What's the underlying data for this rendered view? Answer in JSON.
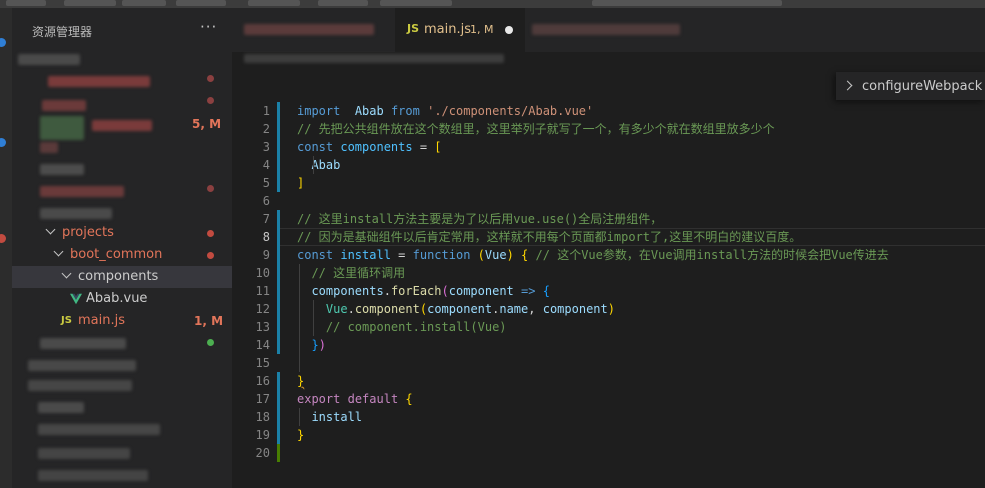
{
  "explorer": {
    "title": "资源管理器",
    "more": "···",
    "tree": [
      {
        "label": "projects",
        "indent": 1,
        "color": "#e2755a",
        "indicator": "#c24b40"
      },
      {
        "label": "boot_common",
        "indent": 2,
        "color": "#e2755a",
        "indicator": "#c24b40"
      },
      {
        "label": "components",
        "indent": 3,
        "color": "#cccccc",
        "selected": true
      },
      {
        "label": "Abab.vue",
        "indent": 4,
        "color": "#cccccc",
        "icon": "vue-icon"
      },
      {
        "label": "main.js",
        "indent": 3,
        "color": "#e2755a",
        "icon": "js-icon",
        "badge": "1, M"
      }
    ],
    "badges": {
      "top": "5, M"
    }
  },
  "tab": {
    "icon": "JS",
    "name": "main.js",
    "badge": "1, M",
    "dirty": true
  },
  "sticky_scroll": {
    "label": "configureWebpack"
  },
  "editor": {
    "active_line": 8,
    "lines": [
      [
        [
          "kw",
          "import"
        ],
        [
          "",
          "  "
        ],
        [
          "var",
          "Abab"
        ],
        [
          "",
          " "
        ],
        [
          "kw",
          "from"
        ],
        [
          "",
          " "
        ],
        [
          "str",
          "'./components/Abab.vue'"
        ]
      ],
      [
        [
          "cm",
          "// 先把公共组件放在这个数组里，这里举列子就写了一个，有多少个就在数组里放多少个"
        ]
      ],
      [
        [
          "kw",
          "const"
        ],
        [
          "",
          " "
        ],
        [
          "cst",
          "components"
        ],
        [
          "",
          " = "
        ],
        [
          "br1",
          "["
        ]
      ],
      [
        [
          "",
          "  "
        ],
        [
          "var",
          "Abab"
        ]
      ],
      [
        [
          "br1",
          "]"
        ]
      ],
      [],
      [
        [
          "cm",
          "// 这里install方法主要是为了以后用vue.use()全局注册组件，"
        ]
      ],
      [
        [
          "cm",
          "// 因为是基础组件以后肯定常用，这样就不用每个页面都import了,这里不明白的建议百度。"
        ]
      ],
      [
        [
          "kw",
          "const"
        ],
        [
          "",
          " "
        ],
        [
          "cst",
          "install"
        ],
        [
          "",
          " = "
        ],
        [
          "kw",
          "function"
        ],
        [
          "",
          " "
        ],
        [
          "br1",
          "("
        ],
        [
          "var",
          "Vue"
        ],
        [
          "br1",
          ")"
        ],
        [
          "",
          " "
        ],
        [
          "br1",
          "{"
        ],
        [
          "",
          " "
        ],
        [
          "cm",
          "// 这个Vue参数，在Vue调用install方法的时候会把Vue传进去"
        ]
      ],
      [
        [
          "",
          "  "
        ],
        [
          "cm",
          "// 这里循环调用"
        ]
      ],
      [
        [
          "",
          "  "
        ],
        [
          "var",
          "components"
        ],
        [
          "",
          "."
        ],
        [
          "fn",
          "forEach"
        ],
        [
          "br2",
          "("
        ],
        [
          "var",
          "component"
        ],
        [
          "",
          " "
        ],
        [
          "kw",
          "=>"
        ],
        [
          "",
          " "
        ],
        [
          "br3",
          "{"
        ]
      ],
      [
        [
          "",
          "    "
        ],
        [
          "cls",
          "Vue"
        ],
        [
          "",
          "."
        ],
        [
          "fn",
          "component"
        ],
        [
          "br1",
          "("
        ],
        [
          "var",
          "component"
        ],
        [
          "",
          "."
        ],
        [
          "var",
          "name"
        ],
        [
          "",
          ", "
        ],
        [
          "var",
          "component"
        ],
        [
          "br1",
          ")"
        ]
      ],
      [
        [
          "",
          "    "
        ],
        [
          "cm",
          "// component.install(Vue)"
        ]
      ],
      [
        [
          "",
          "  "
        ],
        [
          "br3",
          "}"
        ],
        [
          "br2",
          ")"
        ]
      ],
      [],
      [
        [
          "br1sq",
          "}"
        ]
      ],
      [
        [
          "cf",
          "export"
        ],
        [
          "",
          " "
        ],
        [
          "cf",
          "default"
        ],
        [
          "",
          " "
        ],
        [
          "br1",
          "{"
        ]
      ],
      [
        [
          "",
          "  "
        ],
        [
          "var",
          "install"
        ]
      ],
      [
        [
          "br1",
          "}"
        ]
      ],
      []
    ],
    "gutter_marks": [
      {
        "from": 1,
        "to": 4,
        "color": "#1b81a8"
      },
      {
        "from": 5,
        "to": 5,
        "color": "#1b81a8"
      },
      {
        "from": 7,
        "to": 8,
        "color": "#1b81a8"
      },
      {
        "from": 9,
        "to": 14,
        "color": "#1b81a8"
      },
      {
        "from": 16,
        "to": 16,
        "color": "#1b81a8"
      },
      {
        "from": 17,
        "to": 19,
        "color": "#1b81a8"
      },
      {
        "from": 20,
        "to": 20,
        "color": "#487e02"
      }
    ]
  }
}
